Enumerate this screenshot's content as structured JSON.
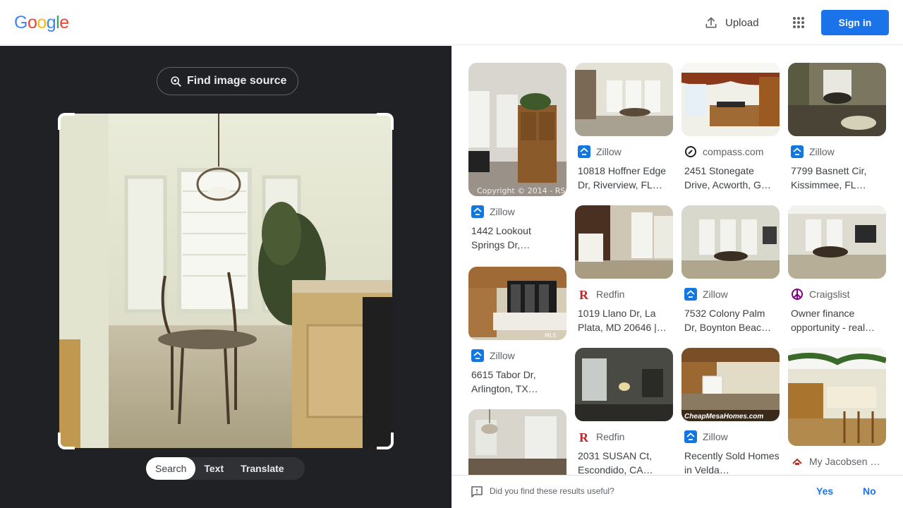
{
  "header": {
    "logo_letters": [
      "G",
      "o",
      "o",
      "g",
      "l",
      "e"
    ],
    "logo_colors": [
      "#4285F4",
      "#EA4335",
      "#FBBC05",
      "#4285F4",
      "#34A853",
      "#EA4335"
    ],
    "upload_label": "Upload",
    "signin_label": "Sign in"
  },
  "lens": {
    "find_source_label": "Find image source",
    "tabs": [
      "Search",
      "Text",
      "Translate"
    ],
    "active_tab": "Search"
  },
  "results": [
    {
      "source": "Zillow",
      "source_icon": "zillow-icon",
      "title": "1442 Lookout Springs Dr,…",
      "overlay": "Copyright © 2014 - RSC"
    },
    {
      "source": "Zillow",
      "source_icon": "zillow-icon",
      "title": "10818 Hoffner Edge Dr, Riverview, FL…"
    },
    {
      "source": "compass.com",
      "source_icon": "compass-icon",
      "title": "2451 Stonegate Drive, Acworth, G…"
    },
    {
      "source": "Zillow",
      "source_icon": "zillow-icon",
      "title": "7799 Basnett Cir, Kissimmee, FL…"
    },
    {
      "source": "Zillow",
      "source_icon": "zillow-icon",
      "title": "6615 Tabor Dr, Arlington, TX…",
      "overlay": "MLS"
    },
    {
      "source": "Redfin",
      "source_icon": "redfin-icon",
      "title": "1019 Llano Dr, La Plata, MD 20646 |…"
    },
    {
      "source": "Zillow",
      "source_icon": "zillow-icon",
      "title": "7532 Colony Palm Dr, Boynton Beac…"
    },
    {
      "source": "Craigslist",
      "source_icon": "craigslist-icon",
      "title": "Owner finance opportunity - real…"
    },
    {
      "source": "Redfin",
      "source_icon": "redfin-icon",
      "title": "2031 SUSAN Ct, Escondido, CA…"
    },
    {
      "source": "Zillow",
      "source_icon": "zillow-icon",
      "title": "Recently Sold Homes in Velda…",
      "overlay": "CheapMesaHomes.com"
    },
    {
      "source": "My Jacobsen …",
      "source_icon": "jacobsen-icon",
      "title": ""
    }
  ],
  "feedback": {
    "question": "Did you find these results useful?",
    "yes": "Yes",
    "no": "No"
  },
  "colors": {
    "accent": "#1a73e8",
    "dark_panel": "#202124",
    "zillow": "#1277E1",
    "redfin": "#C82021",
    "craigslist": "#800080"
  }
}
